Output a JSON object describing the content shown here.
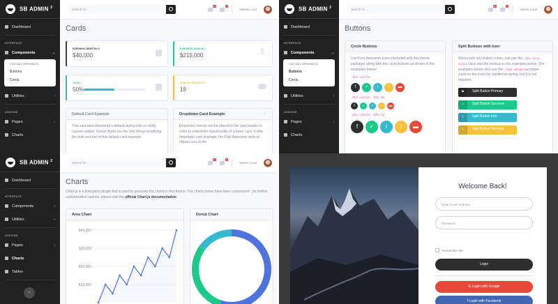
{
  "brand": "SB ADMIN",
  "brand_sup": "2",
  "search_placeholder": "Search for...",
  "user_name": "Valerie Luna",
  "badges": {
    "alerts": "3+",
    "messages": "7"
  },
  "sidebar": {
    "dashboard": "Dashboard",
    "interface_heading": "INTERFACE",
    "components": "Components",
    "utilities": "Utilities",
    "addons_heading": "ADDONS",
    "pages": "Pages",
    "charts": "Charts",
    "tables": "Tables",
    "submenu_heading": "CUSTOM COMPONENTS:",
    "submenu_buttons": "Buttons",
    "submenu_cards": "Cards"
  },
  "cards_page": {
    "title": "Cards",
    "stats": [
      {
        "label": "EARNINGS (MONTHLY)",
        "value": "$40,000",
        "color": "#3a3b45"
      },
      {
        "label": "EARNINGS (ANNUAL)",
        "value": "$215,000",
        "color": "#1cc88a"
      },
      {
        "label": "TASKS",
        "value": "50%",
        "color": "#36b9cc",
        "progress": 0.5
      },
      {
        "label": "PENDING REQUESTS",
        "value": "18",
        "color": "#f6c23e"
      }
    ],
    "default_card": {
      "title": "Default Card Example",
      "body": "This card uses Bootstrap's default styling with no utility classes added. Global styles are the only things modifying the look and feel of this default card example."
    },
    "dropdown_card": {
      "title": "Dropdown Card Example",
      "body": "Dropdown menus can be placed in the card header in order to extend the functionality of a basic card. In this dropdown card example, the Font Awesome vertical ellipsis icon in the"
    }
  },
  "buttons_page": {
    "title": "Buttons",
    "circle": {
      "title": "Circle Buttons",
      "desc": "Use Font Awesome Icons (included with this theme package) along with the circle buttons as shown in the examples below!",
      "class_default": ".btn-circle",
      "class_sm": ".btn-circle .btn-sm",
      "class_lg": ".btn-circle .btn-lg"
    },
    "split": {
      "title": "Split Buttons with Icon",
      "desc_1": "Works with any button colors, just use the",
      "desc_code_1": ".btn-icon-split",
      "desc_2": "class and the markup in the examples below. The examples below also use the",
      "desc_code_2": ".text-white-50",
      "desc_3": "helper class on the icons for additional styling, but it is not required.",
      "buttons": [
        {
          "label": "Split Button Primary",
          "color": "#2e2e2e"
        },
        {
          "label": "Split Button Success",
          "color": "#1cc88a"
        },
        {
          "label": "Split Button Info",
          "color": "#36b9cc"
        },
        {
          "label": "Split Button Warning",
          "color": "#f6c23e"
        }
      ]
    }
  },
  "charts_page": {
    "title": "Charts",
    "desc": "Chart.js is a third party plugin that is used to generate the charts in this theme. The charts below have been customized - for further customization options, please visit the",
    "desc_link": "official Chart.js documentation",
    "area_title": "Area Chart",
    "donut_title": "Donut Chart"
  },
  "chart_data": [
    {
      "type": "area",
      "title": "Area Chart",
      "ytick_labels": [
        "$40,000",
        "$30,000",
        "$20,000",
        "$10,000"
      ],
      "ylim": [
        0,
        40000
      ],
      "values": [
        0,
        10000,
        5000,
        15000,
        10000,
        20000,
        15000,
        25000,
        20000,
        30000,
        25000,
        40000
      ]
    },
    {
      "type": "pie",
      "title": "Donut Chart",
      "values": [
        55,
        30,
        15
      ],
      "colors": [
        "#4e73df",
        "#1cc88a",
        "#36b9cc"
      ]
    }
  ],
  "login": {
    "welcome": "Welcome Back!",
    "email_placeholder": "Enter Email Address...",
    "password_placeholder": "Password",
    "remember": "Remember Me",
    "login_btn": "Login",
    "google_btn": "Login with Google",
    "facebook_btn": "Login with Facebook"
  }
}
